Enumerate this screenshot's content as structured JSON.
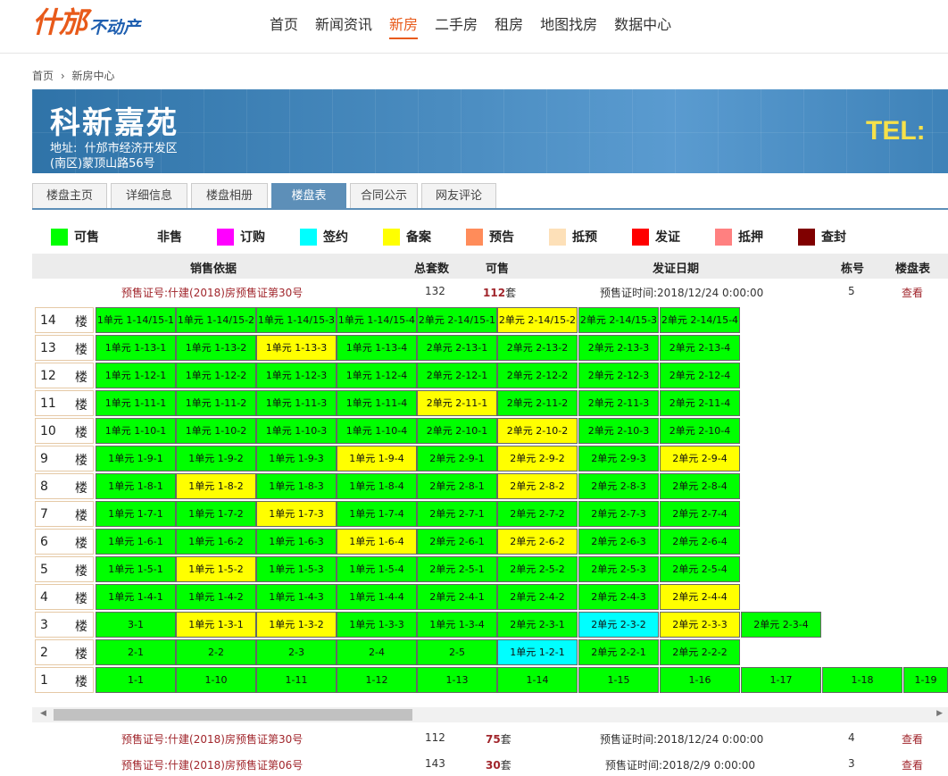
{
  "logo": {
    "brand": "什邡",
    "sub": "不动产"
  },
  "nav": [
    "首页",
    "新闻资讯",
    "新房",
    "二手房",
    "租房",
    "地图找房",
    "数据中心"
  ],
  "breadcrumb": [
    "首页",
    "新房中心"
  ],
  "project": {
    "name": "科新嘉苑",
    "address_label": "地址:",
    "address_line1": "什邡市经济开发区",
    "address_line2": "(南区)蒙顶山路56号",
    "tel": "TEL:"
  },
  "tabs": [
    "楼盘主页",
    "详细信息",
    "楼盘相册",
    "楼盘表",
    "合同公示",
    "网友评论"
  ],
  "legend": [
    {
      "label": "可售",
      "color": "#00ff00"
    },
    {
      "label": "非售",
      "color": "#ffffff"
    },
    {
      "label": "订购",
      "color": "#ff00ff"
    },
    {
      "label": "签约",
      "color": "#00ffff"
    },
    {
      "label": "备案",
      "color": "#ffff00"
    },
    {
      "label": "预告",
      "color": "#ff8c5a"
    },
    {
      "label": "抵预",
      "color": "#fde0b8"
    },
    {
      "label": "发证",
      "color": "#ff0000"
    },
    {
      "label": "抵押",
      "color": "#ff8080"
    },
    {
      "label": "查封",
      "color": "#800000"
    }
  ],
  "table_header": {
    "basis": "销售依据",
    "total": "总套数",
    "available": "可售",
    "cert_date": "发证日期",
    "building": "栋号",
    "table": "楼盘表"
  },
  "permits": [
    {
      "basis": "预售证号:什建(2018)房预售证第30号",
      "total": "132",
      "available": "112",
      "unit": "套",
      "time": "预售证时间:2018/12/24 0:00:00",
      "building": "5",
      "view": "查看"
    },
    {
      "basis": "预售证号:什建(2018)房预售证第30号",
      "total": "112",
      "available": "75",
      "unit": "套",
      "time": "预售证时间:2018/12/24 0:00:00",
      "building": "4",
      "view": "查看"
    },
    {
      "basis": "预售证号:什建(2018)房预售证第06号",
      "total": "143",
      "available": "30",
      "unit": "套",
      "time": "预售证时间:2018/2/9 0:00:00",
      "building": "3",
      "view": "查看"
    }
  ],
  "floor_suffix": "楼",
  "floors": [
    {
      "floor": "14",
      "units": [
        [
          "1单元 1-14/15-1",
          "g"
        ],
        [
          "1单元 1-14/15-2",
          "g"
        ],
        [
          "1单元 1-14/15-3",
          "g"
        ],
        [
          "1单元 1-14/15-4",
          "g"
        ],
        [
          "2单元 2-14/15-1",
          "g"
        ],
        [
          "2单元 2-14/15-2",
          "y"
        ],
        [
          "2单元 2-14/15-3",
          "g"
        ],
        [
          "2单元 2-14/15-4",
          "g"
        ]
      ]
    },
    {
      "floor": "13",
      "units": [
        [
          "1单元 1-13-1",
          "g"
        ],
        [
          "1单元 1-13-2",
          "g"
        ],
        [
          "1单元 1-13-3",
          "y"
        ],
        [
          "1单元 1-13-4",
          "g"
        ],
        [
          "2单元 2-13-1",
          "g"
        ],
        [
          "2单元 2-13-2",
          "g"
        ],
        [
          "2单元 2-13-3",
          "g"
        ],
        [
          "2单元 2-13-4",
          "g"
        ]
      ]
    },
    {
      "floor": "12",
      "units": [
        [
          "1单元 1-12-1",
          "g"
        ],
        [
          "1单元 1-12-2",
          "g"
        ],
        [
          "1单元 1-12-3",
          "g"
        ],
        [
          "1单元 1-12-4",
          "g"
        ],
        [
          "2单元 2-12-1",
          "g"
        ],
        [
          "2单元 2-12-2",
          "g"
        ],
        [
          "2单元 2-12-3",
          "g"
        ],
        [
          "2单元 2-12-4",
          "g"
        ]
      ]
    },
    {
      "floor": "11",
      "units": [
        [
          "1单元 1-11-1",
          "g"
        ],
        [
          "1单元 1-11-2",
          "g"
        ],
        [
          "1单元 1-11-3",
          "g"
        ],
        [
          "1单元 1-11-4",
          "g"
        ],
        [
          "2单元 2-11-1",
          "y"
        ],
        [
          "2单元 2-11-2",
          "g"
        ],
        [
          "2单元 2-11-3",
          "g"
        ],
        [
          "2单元 2-11-4",
          "g"
        ]
      ]
    },
    {
      "floor": "10",
      "units": [
        [
          "1单元 1-10-1",
          "g"
        ],
        [
          "1单元 1-10-2",
          "g"
        ],
        [
          "1单元 1-10-3",
          "g"
        ],
        [
          "1单元 1-10-4",
          "g"
        ],
        [
          "2单元 2-10-1",
          "g"
        ],
        [
          "2单元 2-10-2",
          "y"
        ],
        [
          "2单元 2-10-3",
          "g"
        ],
        [
          "2单元 2-10-4",
          "g"
        ]
      ]
    },
    {
      "floor": "9",
      "units": [
        [
          "1单元 1-9-1",
          "g"
        ],
        [
          "1单元 1-9-2",
          "g"
        ],
        [
          "1单元 1-9-3",
          "g"
        ],
        [
          "1单元 1-9-4",
          "y"
        ],
        [
          "2单元 2-9-1",
          "g"
        ],
        [
          "2单元 2-9-2",
          "y"
        ],
        [
          "2单元 2-9-3",
          "g"
        ],
        [
          "2单元 2-9-4",
          "y"
        ]
      ]
    },
    {
      "floor": "8",
      "units": [
        [
          "1单元 1-8-1",
          "g"
        ],
        [
          "1单元 1-8-2",
          "y"
        ],
        [
          "1单元 1-8-3",
          "g"
        ],
        [
          "1单元 1-8-4",
          "g"
        ],
        [
          "2单元 2-8-1",
          "g"
        ],
        [
          "2单元 2-8-2",
          "y"
        ],
        [
          "2单元 2-8-3",
          "g"
        ],
        [
          "2单元 2-8-4",
          "g"
        ]
      ]
    },
    {
      "floor": "7",
      "units": [
        [
          "1单元 1-7-1",
          "g"
        ],
        [
          "1单元 1-7-2",
          "g"
        ],
        [
          "1单元 1-7-3",
          "y"
        ],
        [
          "1单元 1-7-4",
          "g"
        ],
        [
          "2单元 2-7-1",
          "g"
        ],
        [
          "2单元 2-7-2",
          "g"
        ],
        [
          "2单元 2-7-3",
          "g"
        ],
        [
          "2单元 2-7-4",
          "g"
        ]
      ]
    },
    {
      "floor": "6",
      "units": [
        [
          "1单元 1-6-1",
          "g"
        ],
        [
          "1单元 1-6-2",
          "g"
        ],
        [
          "1单元 1-6-3",
          "g"
        ],
        [
          "1单元 1-6-4",
          "y"
        ],
        [
          "2单元 2-6-1",
          "g"
        ],
        [
          "2单元 2-6-2",
          "y"
        ],
        [
          "2单元 2-6-3",
          "g"
        ],
        [
          "2单元 2-6-4",
          "g"
        ]
      ]
    },
    {
      "floor": "5",
      "units": [
        [
          "1单元 1-5-1",
          "g"
        ],
        [
          "1单元 1-5-2",
          "y"
        ],
        [
          "1单元 1-5-3",
          "g"
        ],
        [
          "1单元 1-5-4",
          "g"
        ],
        [
          "2单元 2-5-1",
          "g"
        ],
        [
          "2单元 2-5-2",
          "g"
        ],
        [
          "2单元 2-5-3",
          "g"
        ],
        [
          "2单元 2-5-4",
          "g"
        ]
      ]
    },
    {
      "floor": "4",
      "units": [
        [
          "1单元 1-4-1",
          "g"
        ],
        [
          "1单元 1-4-2",
          "g"
        ],
        [
          "1单元 1-4-3",
          "g"
        ],
        [
          "1单元 1-4-4",
          "g"
        ],
        [
          "2单元 2-4-1",
          "g"
        ],
        [
          "2单元 2-4-2",
          "g"
        ],
        [
          "2单元 2-4-3",
          "g"
        ],
        [
          "2单元 2-4-4",
          "y"
        ]
      ]
    },
    {
      "floor": "3",
      "units": [
        [
          "3-1",
          "g"
        ],
        [
          "1单元 1-3-1",
          "y"
        ],
        [
          "1单元 1-3-2",
          "y"
        ],
        [
          "1单元 1-3-3",
          "g"
        ],
        [
          "1单元 1-3-4",
          "g"
        ],
        [
          "2单元 2-3-1",
          "g"
        ],
        [
          "2单元 2-3-2",
          "c"
        ],
        [
          "2单元 2-3-3",
          "y"
        ],
        [
          "2单元 2-3-4",
          "g"
        ]
      ]
    },
    {
      "floor": "2",
      "units": [
        [
          "2-1",
          "g"
        ],
        [
          "2-2",
          "g"
        ],
        [
          "2-3",
          "g"
        ],
        [
          "2-4",
          "g"
        ],
        [
          "2-5",
          "g"
        ],
        [
          "1单元 1-2-1",
          "c"
        ],
        [
          "2单元 2-2-1",
          "g"
        ],
        [
          "2单元 2-2-2",
          "g"
        ]
      ]
    },
    {
      "floor": "1",
      "units": [
        [
          "1-1",
          "g"
        ],
        [
          "1-10",
          "g"
        ],
        [
          "1-11",
          "g"
        ],
        [
          "1-12",
          "g"
        ],
        [
          "1-13",
          "g"
        ],
        [
          "1-14",
          "g"
        ],
        [
          "1-15",
          "g"
        ],
        [
          "1-16",
          "g"
        ],
        [
          "1-17",
          "g"
        ],
        [
          "1-18",
          "g"
        ],
        [
          "1-19",
          "g"
        ]
      ]
    }
  ]
}
